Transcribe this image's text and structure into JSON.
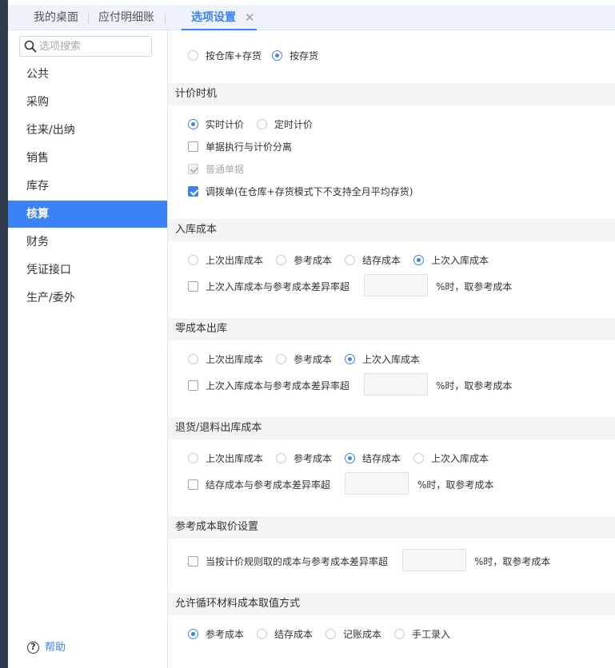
{
  "tabs": [
    {
      "label": "我的桌面"
    },
    {
      "label": "应付明细账"
    },
    {
      "label": "选项设置",
      "active": true
    }
  ],
  "tab_close_glyph": "✕",
  "sidebar": {
    "search_placeholder": "选项搜索",
    "items": [
      {
        "label": "公共"
      },
      {
        "label": "采购"
      },
      {
        "label": "往来/出纳"
      },
      {
        "label": "销售"
      },
      {
        "label": "库存"
      },
      {
        "label": "核算",
        "active": true
      },
      {
        "label": "财务"
      },
      {
        "label": "凭证接口"
      },
      {
        "label": "生产/委外"
      }
    ],
    "help_label": "帮助",
    "help_glyph": "?"
  },
  "accent_color": "#3b82f6",
  "main": {
    "top_options": {
      "opt1": "按仓库+存货",
      "opt2": "按存货",
      "selected": "按存货"
    },
    "pricing_timing": {
      "title": "计价时机",
      "opt_realtime": "实时计价",
      "opt_scheduled": "定时计价",
      "selected": "实时计价",
      "chk_separate": "单据执行与计价分离",
      "chk_separate_checked": false,
      "chk_normal": "普通单据",
      "chk_normal_checked": true,
      "chk_normal_disabled": true,
      "chk_transfer": "调拨单(在仓库+存货模式下不支持全月平均存货)",
      "chk_transfer_checked": true
    },
    "inbound_cost": {
      "title": "入库成本",
      "options": [
        "上次出库成本",
        "参考成本",
        "结存成本",
        "上次入库成本"
      ],
      "selected": "上次入库成本",
      "chk_label": "上次入库成本与参考成本差异率超",
      "chk_checked": false,
      "suffix": "%时，取参考成本",
      "value": ""
    },
    "zero_cost_outbound": {
      "title": "零成本出库",
      "options": [
        "上次出库成本",
        "参考成本",
        "上次入库成本"
      ],
      "selected": "上次入库成本",
      "chk_label": "上次入库成本与参考成本差异率超",
      "chk_checked": false,
      "suffix": "%时，取参考成本",
      "value": ""
    },
    "return_cost": {
      "title": "退货/退料出库成本",
      "options": [
        "上次出库成本",
        "参考成本",
        "结存成本",
        "上次入库成本"
      ],
      "selected": "结存成本",
      "chk_label": "结存成本与参考成本差异率超",
      "chk_checked": false,
      "suffix": "%时，取参考成本",
      "value": ""
    },
    "ref_cost_setting": {
      "title": "参考成本取价设置",
      "chk_label": "当按计价规则取的成本与参考成本差异率超",
      "chk_checked": false,
      "suffix": "%时，取参考成本",
      "value": ""
    },
    "cycle_material": {
      "title": "允许循环材料成本取值方式",
      "options": [
        "参考成本",
        "结存成本",
        "记账成本",
        "手工录入"
      ],
      "selected": "参考成本"
    }
  }
}
